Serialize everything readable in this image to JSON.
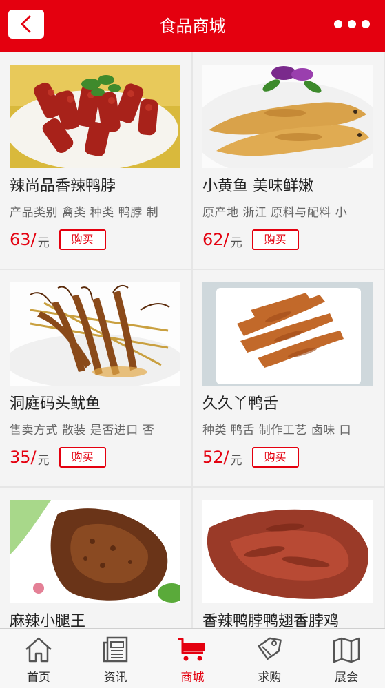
{
  "header": {
    "title": "食品商城"
  },
  "products": [
    {
      "name": "辣尚品香辣鸭脖",
      "spec": "产品类别 禽类 种类 鸭脖 制",
      "price": "63/",
      "unit": "元",
      "buy_label": "购买"
    },
    {
      "name": "小黄鱼 美味鲜嫩",
      "spec": "原产地 浙江 原料与配料 小",
      "price": "62/",
      "unit": "元",
      "buy_label": "购买"
    },
    {
      "name": "洞庭码头鱿鱼",
      "spec": "售卖方式 散装 是否进口 否",
      "price": "35/",
      "unit": "元",
      "buy_label": "购买"
    },
    {
      "name": "久久丫鸭舌",
      "spec": "种类 鸭舌 制作工艺 卤味 口",
      "price": "52/",
      "unit": "元",
      "buy_label": "购买"
    },
    {
      "name": "麻辣小腿王"
    },
    {
      "name": "香辣鸭脖鸭翅香脖鸡"
    }
  ],
  "tabs": [
    {
      "label": "首页",
      "icon": "home-icon"
    },
    {
      "label": "资讯",
      "icon": "news-icon"
    },
    {
      "label": "商城",
      "icon": "cart-icon",
      "active": true
    },
    {
      "label": "求购",
      "icon": "tag-icon"
    },
    {
      "label": "展会",
      "icon": "map-icon"
    }
  ],
  "colors": {
    "accent": "#e4000f",
    "text": "#222222",
    "muted": "#666666"
  }
}
